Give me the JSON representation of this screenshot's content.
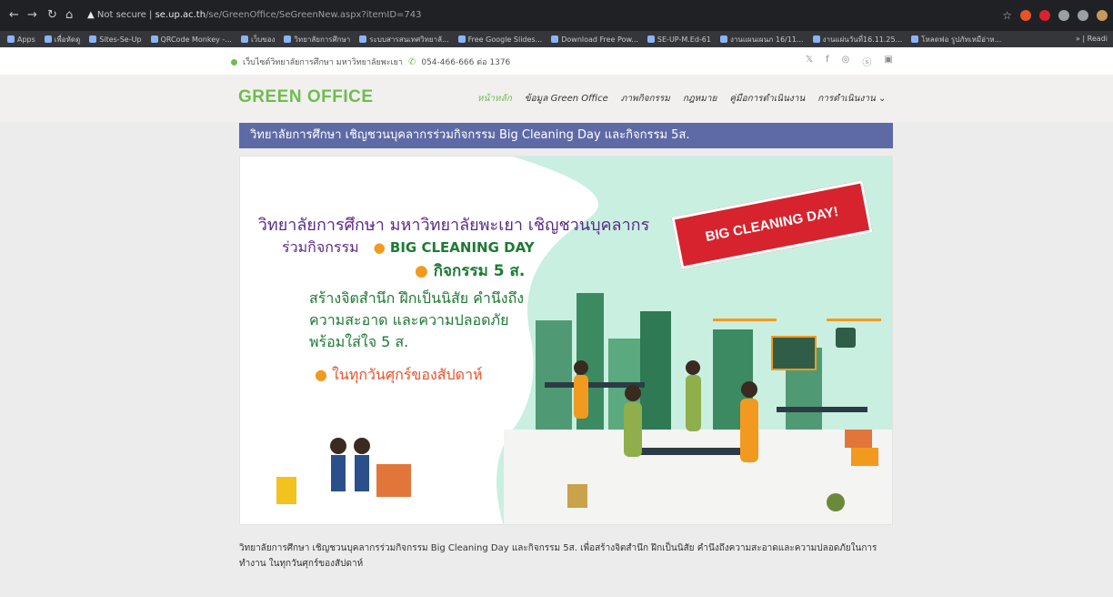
{
  "browser": {
    "nav_icons": [
      "back-icon",
      "forward-icon",
      "reload-icon",
      "home-icon"
    ],
    "security_label": "Not secure",
    "url_host": "se.up.ac.th",
    "url_path": "/se/GreenOffice/SeGreenNew.aspx?itemID=743",
    "bookmarks": [
      "Apps",
      "เพื่อหัดดู",
      "Sites-Se-Up",
      "QRCode Monkey -...",
      "เว็บของ",
      "วิทยาลัยการศึกษา",
      "ระบบสารสนเทศวิทยาลั...",
      "Free Google Slides...",
      "Download Free Pow...",
      "SE-UP-M.Ed-61",
      "งานแผนเผนภ 16/11...",
      "งานแผ่นวันที่16.11.25...",
      "โหลดฟอ รูปภัทเหมือ่าห..."
    ],
    "bookmarks_overflow": "»",
    "reading_list": "Readi"
  },
  "site": {
    "tagline": "เว็บไซต์วิทยาลัยการศึกษา มหาวิทยาลัยพะเยา",
    "phone": "054-466-666 ต่อ 1376",
    "socials": [
      "twitter-icon",
      "facebook-icon",
      "instagram-icon",
      "skype-icon",
      "linkedin-icon"
    ],
    "logo": "GREEN OFFICE",
    "menu": [
      {
        "label": "หน้าหลัก",
        "active": true
      },
      {
        "label": "ข้อมูล Green Office",
        "active": false
      },
      {
        "label": "ภาพกิจกรรม",
        "active": false
      },
      {
        "label": "กฎหมาย",
        "active": false
      },
      {
        "label": "คู่มือการดำเนินงาน",
        "active": false
      },
      {
        "label": "การดำเนินงาน ⌄",
        "active": false
      }
    ]
  },
  "article": {
    "title": "วิทยาลัยการศึกษา เชิญชวนบุคลากรร่วมกิจกรรม Big Cleaning Day และกิจกรรม 5ส.",
    "poster": {
      "headline": "วิทยาลัยการศึกษา มหาวิทยาลัยพะเยา เชิญชวนบุคลากร",
      "join": "ร่วมกิจกรรม",
      "item1": "BIG CLEANING DAY",
      "item2": "กิจกรรม 5 ส.",
      "line1": "สร้างจิตสำนึก ฝึกเป็นนิสัย คำนึงถึง",
      "line2": "ความสะอาด และความปลอดภัย",
      "line3": "พร้อมใส่ใจ 5 ส.",
      "every_friday": "ในทุกวันศุกร์ของสัปดาห์",
      "banner": "BIG CLEANING DAY!"
    },
    "description": "วิทยาลัยการศึกษา เชิญชวนบุคลากรร่วมกิจกรรม Big Cleaning Day และกิจกรรม 5ส. เพื่อสร้างจิตสำนึก ฝึกเป็นนิสัย คำนึงถึงความสะอาดและความปลอดภัยในการทำงาน ในทุกวันศุกร์ของสัปดาห์"
  },
  "colors": {
    "brand_green": "#6dbd4f",
    "title_bar": "#5e6aa6",
    "banner_red": "#d7232e",
    "poster_mint": "#c9efe0"
  }
}
